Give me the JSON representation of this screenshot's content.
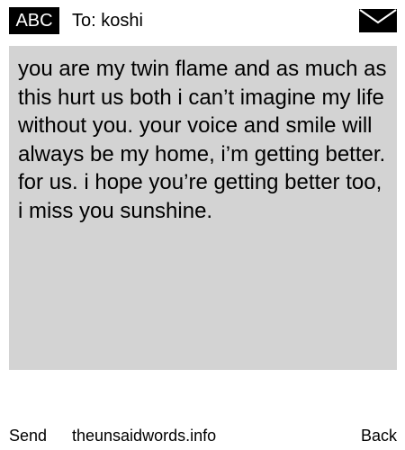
{
  "header": {
    "mode_label": "ABC",
    "recipient_label": "To: koshi",
    "envelope_icon": "envelope-icon"
  },
  "message": {
    "text": "you are my twin flame and as much as this hurt us both i can’t imagine my life without you. your voice and smile will always be my home, i’m getting better. for us. i hope you’re getting better too, i miss you sunshine."
  },
  "footer": {
    "send_label": "Send",
    "site_label": "theunsaidwords.info",
    "back_label": "Back"
  },
  "colors": {
    "background": "#ffffff",
    "message_background": "#d3d3d3",
    "text": "#000000",
    "badge_background": "#000000",
    "badge_text": "#ffffff"
  }
}
